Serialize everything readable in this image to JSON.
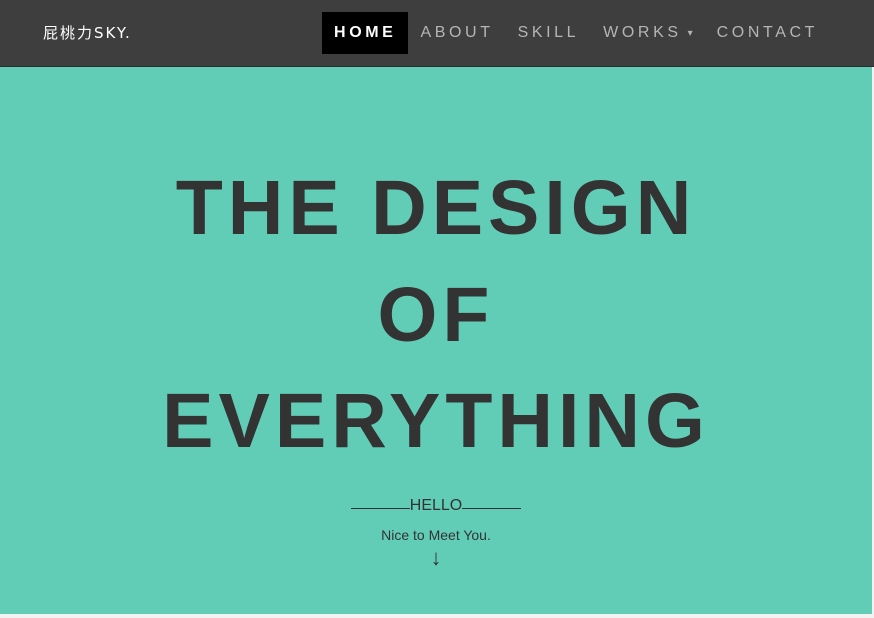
{
  "brand": {
    "label": "屁桃力SKY."
  },
  "nav": {
    "items": [
      {
        "label": "HOME"
      },
      {
        "label": "ABOUT"
      },
      {
        "label": "SKILL"
      },
      {
        "label": "WORKS"
      },
      {
        "label": "CONTACT"
      }
    ],
    "dropdown_caret": "▾"
  },
  "hero": {
    "line1": "THE DESIGN",
    "line2": "OF",
    "line3": "EVERYTHING",
    "hello": "HELLO",
    "tagline": "Nice to Meet You.",
    "arrow": "↓"
  },
  "colors": {
    "navbar": "#3e3e3e",
    "hero_bg": "#62cdb7",
    "text_dark": "#333333",
    "active_nav_bg": "#000000"
  }
}
